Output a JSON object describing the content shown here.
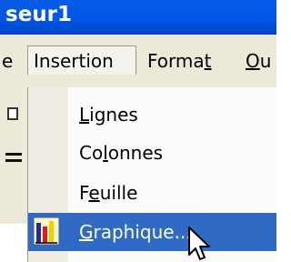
{
  "window": {
    "title": "seur1"
  },
  "menubar": {
    "edge_label": "e",
    "insertion_label": "Insertion",
    "format_label": "Format",
    "format_mnemonic_prefix": "Forma",
    "format_mnemonic_char": "t",
    "ou_label": "Ou",
    "ou_mnemonic_char": "O",
    "ou_rest": "u"
  },
  "insertion_menu": {
    "items": [
      {
        "pre": "",
        "mnemonic": "L",
        "post": "ignes",
        "icon": null,
        "selected": false
      },
      {
        "pre": "Co",
        "mnemonic": "l",
        "post": "onnes",
        "icon": null,
        "selected": false
      },
      {
        "pre": "F",
        "mnemonic": "e",
        "post": "uille",
        "icon": null,
        "selected": false
      },
      {
        "pre": "",
        "mnemonic": "G",
        "post": "raphique...",
        "icon": "chart-icon",
        "selected": true
      }
    ]
  },
  "colors": {
    "titlebar": "#0055e5",
    "menubar_bg": "#ece9d8",
    "selection": "#316ac5"
  }
}
